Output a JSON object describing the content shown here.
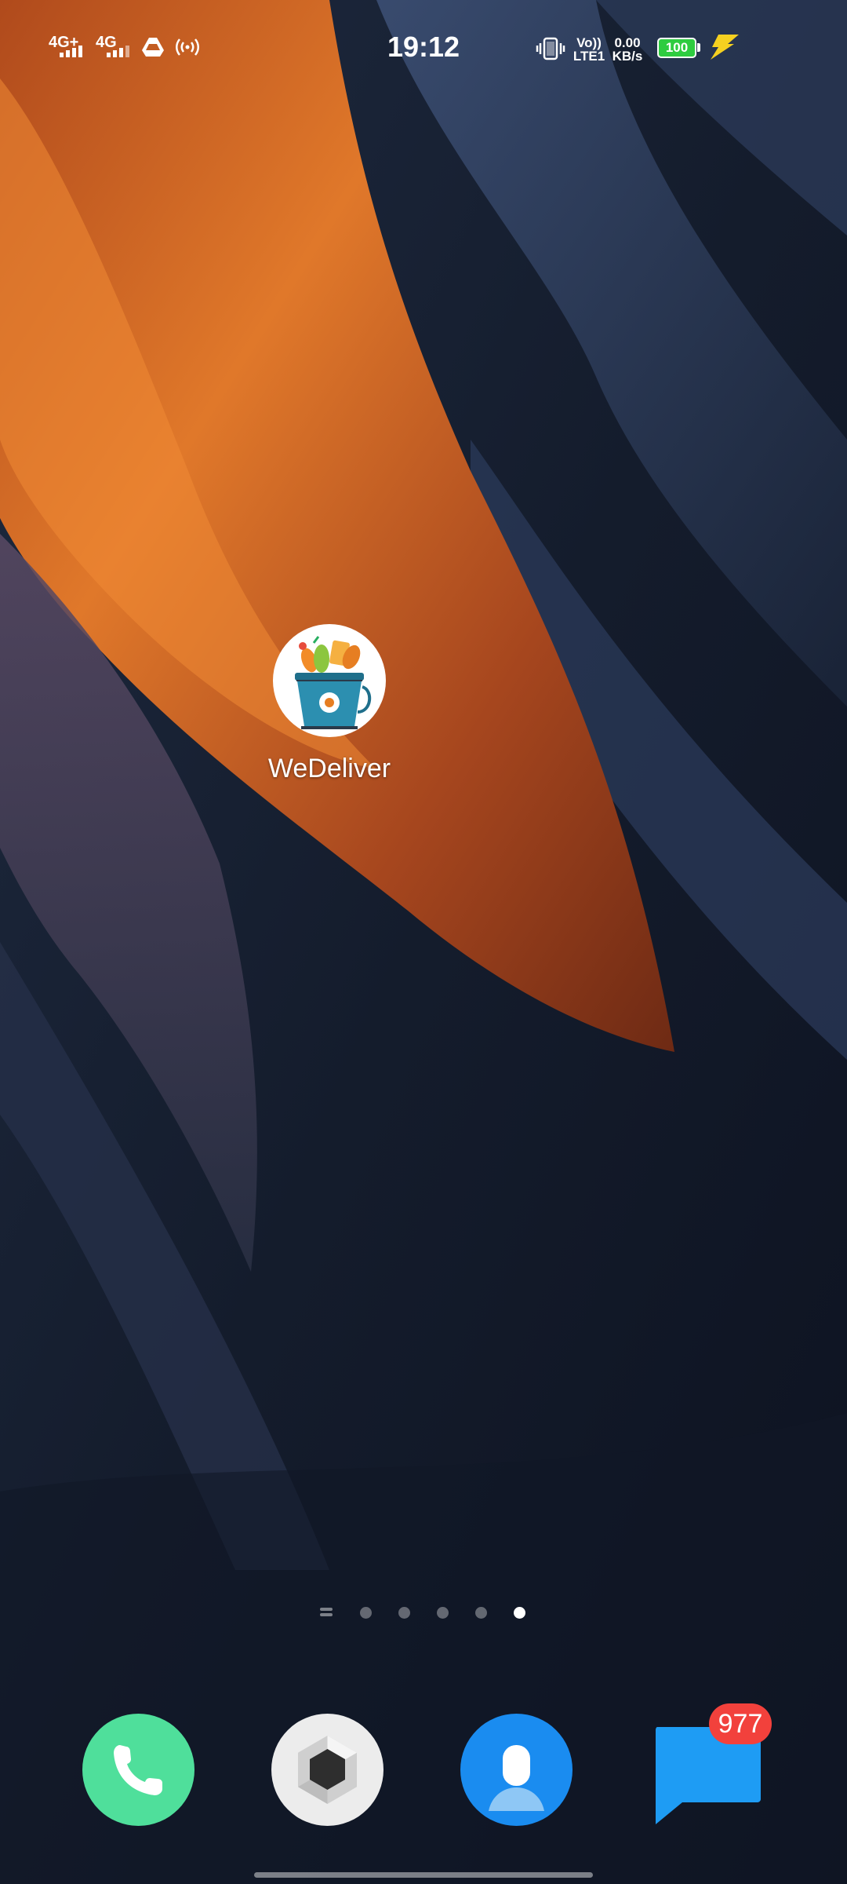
{
  "status_bar": {
    "network1": "4G+",
    "network2": "4G",
    "time": "19:12",
    "volte_top": "Vo))",
    "volte_bottom": "LTE1",
    "speed_value": "0.00",
    "speed_unit": "KB/s",
    "battery_level": "100",
    "battery_color": "#2ecc40",
    "charging_icon_color": "#f5d020"
  },
  "home": {
    "apps": [
      {
        "label": "WeDeliver",
        "icon": "grocery-bucket-icon"
      }
    ]
  },
  "page_indicator": {
    "pages": 5,
    "active_page": 5
  },
  "dock": {
    "phone": {
      "icon": "phone-icon",
      "color": "#4fdf9b"
    },
    "camera": {
      "icon": "camera-icon",
      "color": "#ececec"
    },
    "contacts": {
      "icon": "contacts-icon",
      "color": "#1a8cf0"
    },
    "messages": {
      "icon": "messages-icon",
      "color": "#1e9cf4",
      "badge_count": "977"
    }
  }
}
